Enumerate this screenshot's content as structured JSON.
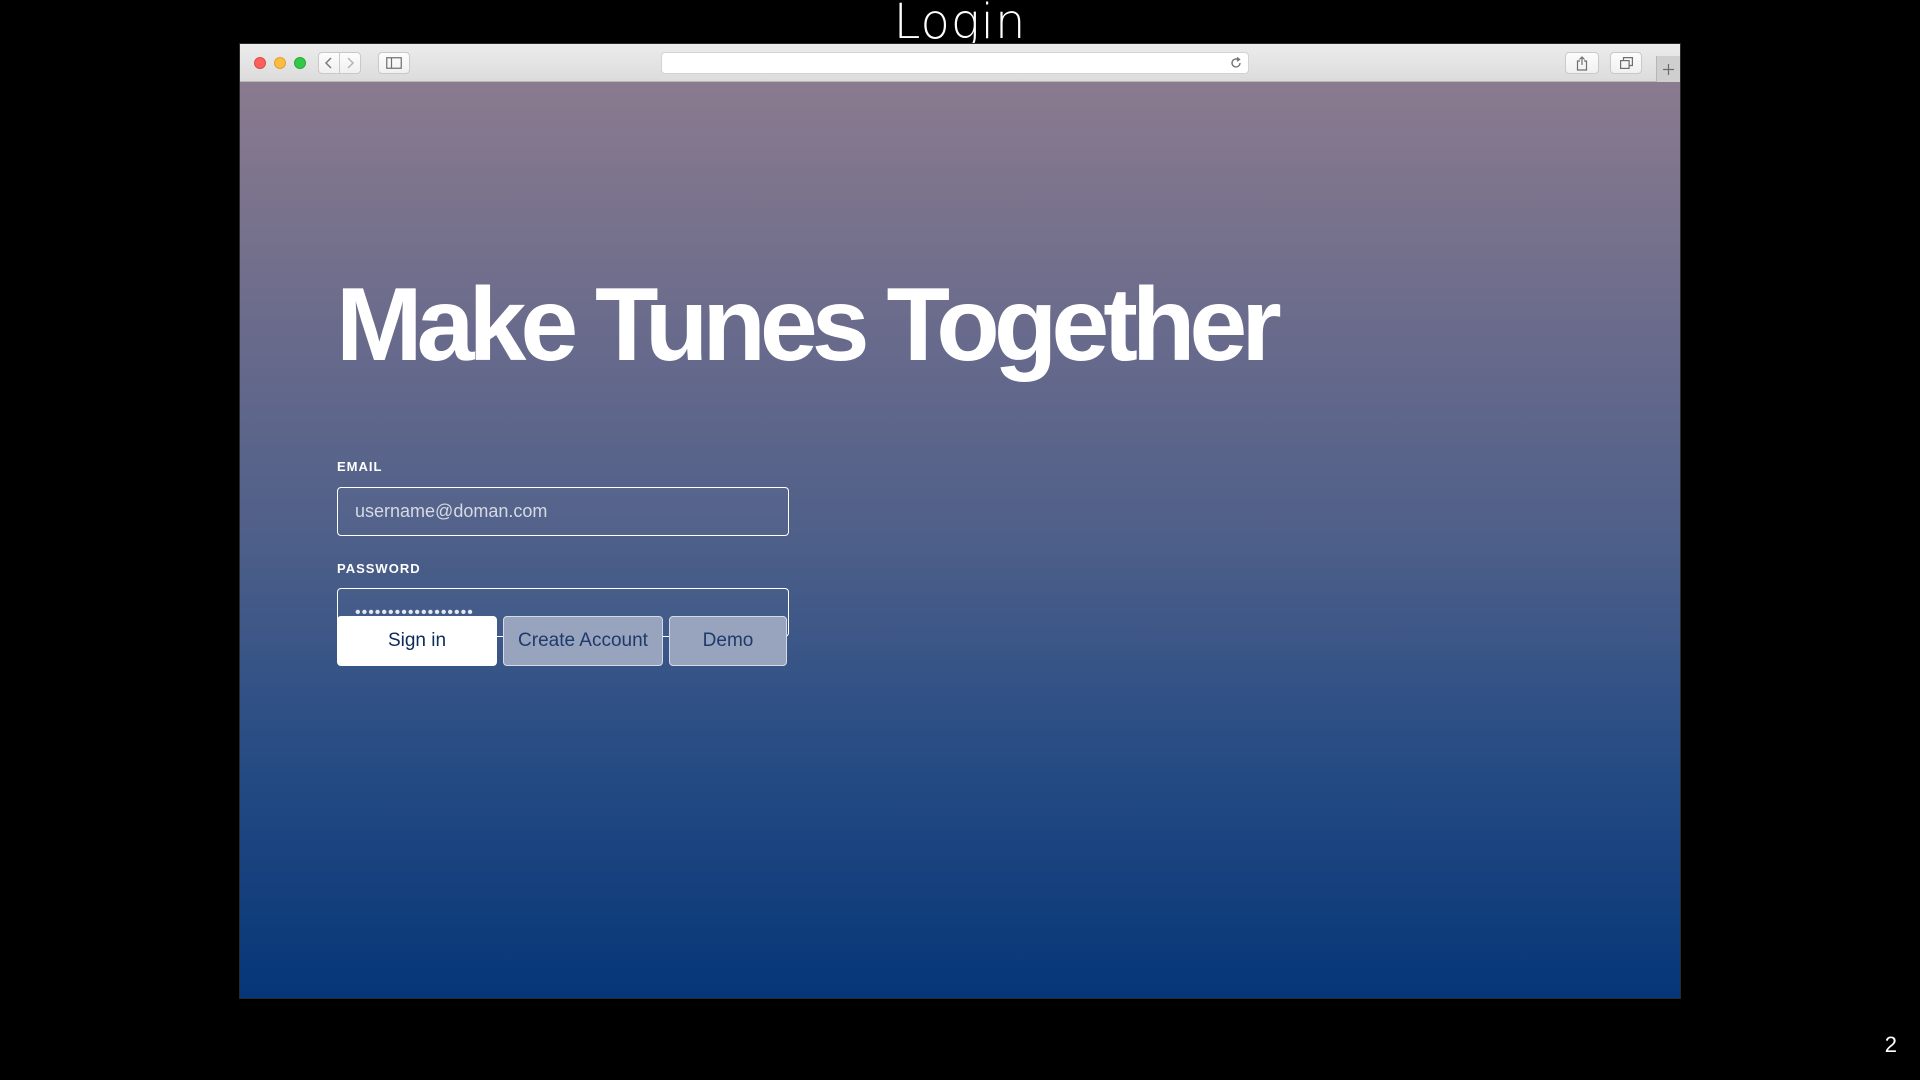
{
  "slide": {
    "title": "Login",
    "page_number": "2"
  },
  "browser": {
    "address_url": ""
  },
  "page": {
    "heading": "Make Tunes Together",
    "email": {
      "label": "EMAIL",
      "placeholder": "username@doman.com",
      "value": ""
    },
    "password": {
      "label": "PASSWORD",
      "value": "••••••••••••••••••"
    },
    "buttons": {
      "sign_in": "Sign in",
      "create_account": "Create Account",
      "demo": "Demo"
    }
  },
  "colors": {
    "gradient_top": "#8a7b8e",
    "gradient_bottom": "#053678",
    "primary_button_bg": "#ffffff",
    "primary_button_text": "#0d2a5a",
    "secondary_button_bg": "#98a3be"
  },
  "icons": [
    "back-icon",
    "forward-icon",
    "sidebar-icon",
    "reload-icon",
    "share-icon",
    "tabs-icon",
    "plus-icon"
  ]
}
